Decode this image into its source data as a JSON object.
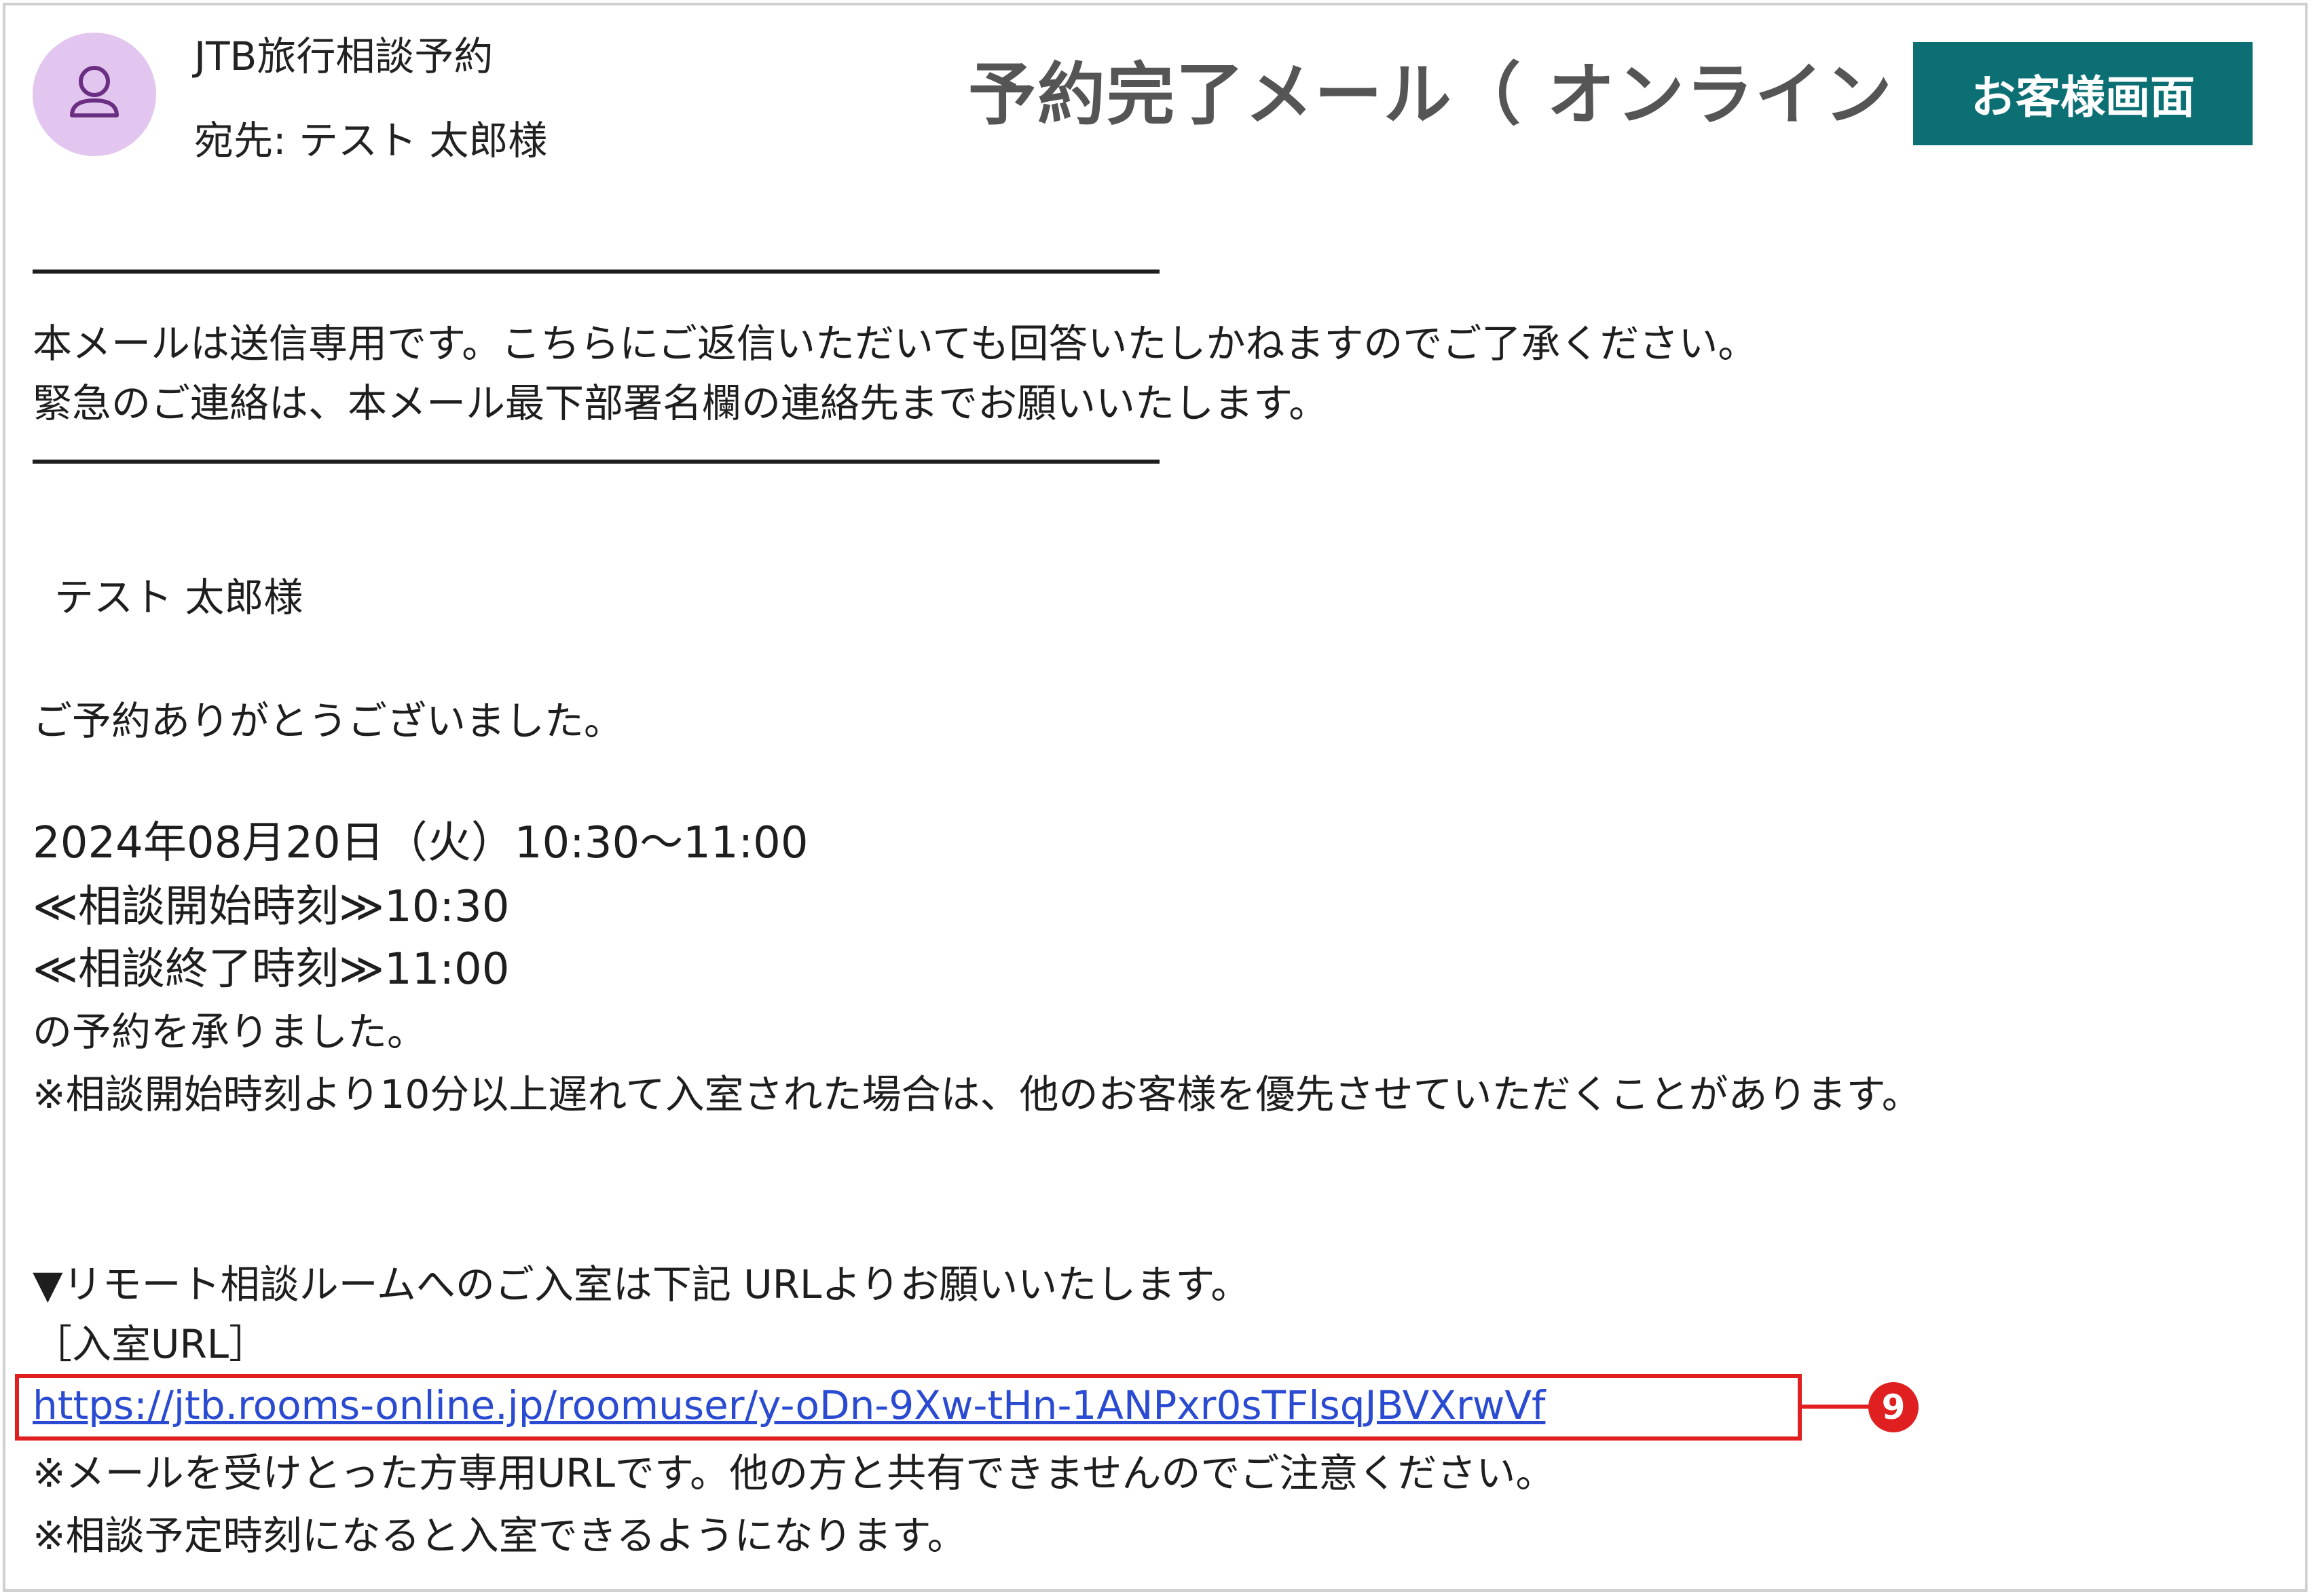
{
  "header": {
    "sender": "JTB旅行相談予約",
    "recipient": "宛先: テスト 太郎様",
    "title": "予約完了メール（ オンライン ）",
    "button_label": "お客様画面",
    "avatar_icon": "person-icon"
  },
  "notice": {
    "line1": "本メールは送信専用です。こちらにご返信いただいても回答いたしかねますのでご了承ください。",
    "line2": "緊急のご連絡は、本メール最下部署名欄の連絡先までお願いいたします。"
  },
  "body": {
    "greeting_name": "テスト 太郎様",
    "thanks": "ご予約ありがとうございました。",
    "datetime": "2024年08月20日（火）10:30〜11:00",
    "start_time": "≪相談開始時刻≫10:30",
    "end_time": "≪相談終了時刻≫11:00",
    "accepted": "の予約を承りました。",
    "late_note": "※相談開始時刻より10分以上遅れて入室された場合は、他のお客様を優先させていただくことがあります。",
    "room_intro": "▼リモート相談ルームへのご入室は下記 URLよりお願いいたします。",
    "url_label": "［入室URL］",
    "url": "https://jtb.rooms-online.jp/roomuser/y-oDn-9Xw-tHn-1ANPxr0sTFlsqJBVXrwVf",
    "url_note": "※メールを受けとった方専用URLです。他の方と共有できませんのでご注意ください。",
    "time_note": "※相談予定時刻になると入室できるようになります。"
  },
  "callout": {
    "number": "9"
  },
  "colors": {
    "button_bg": "#0c6f74",
    "link": "#2a4bd1",
    "highlight": "#e02020",
    "avatar_bg": "#e3c6ef"
  }
}
